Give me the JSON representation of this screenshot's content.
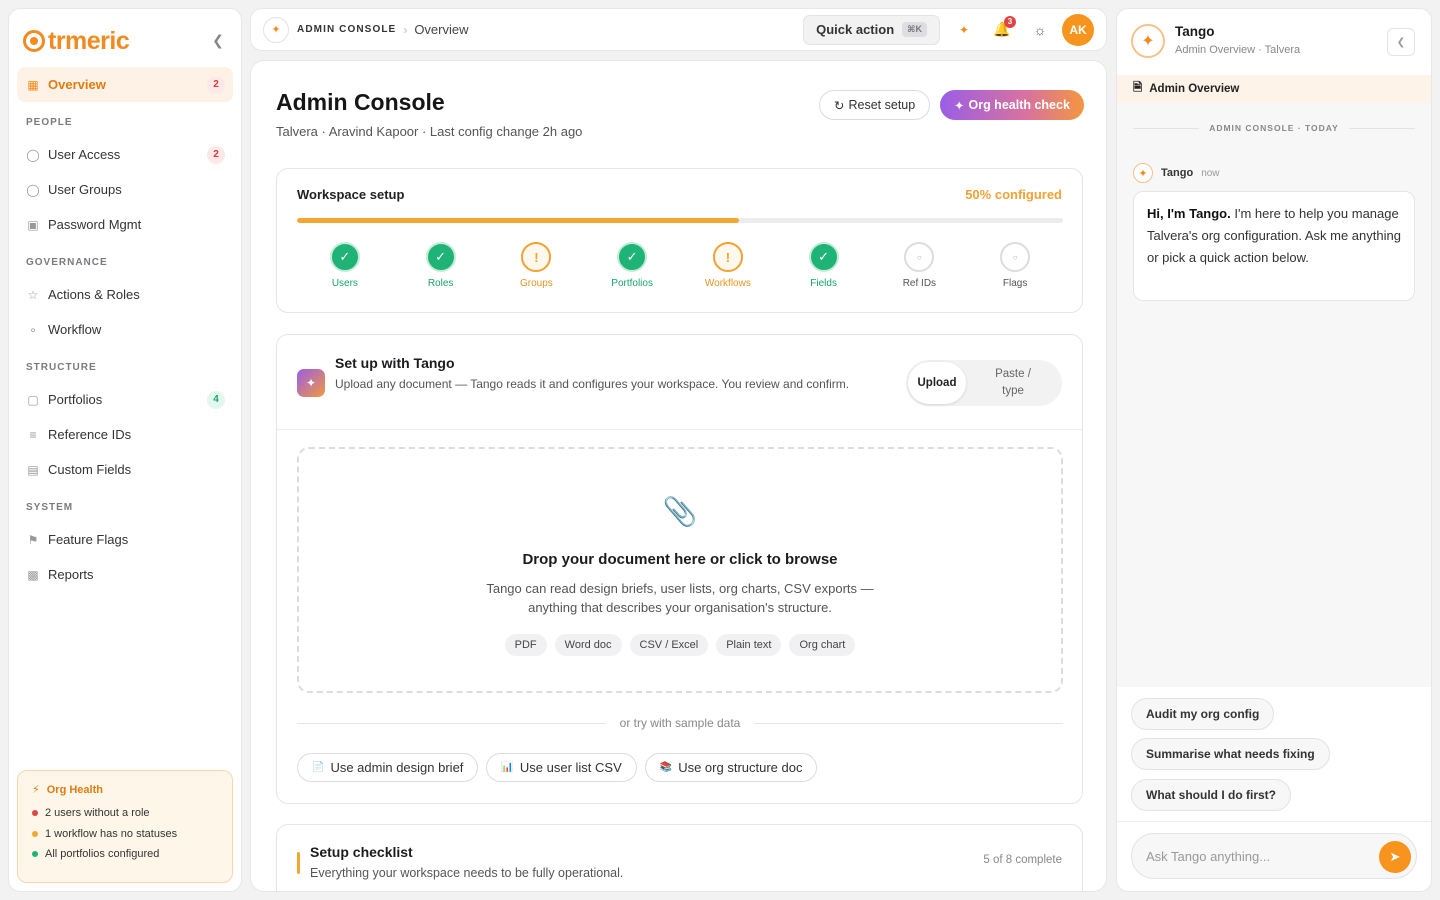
{
  "brand": {
    "name": "trmeric"
  },
  "sidebar": {
    "overview": {
      "label": "Overview",
      "badge": "2"
    },
    "sections": {
      "people": "PEOPLE",
      "governance": "GOVERNANCE",
      "structure": "STRUCTURE",
      "system": "SYSTEM"
    },
    "items": {
      "user_access": {
        "label": "User Access",
        "badge": "2"
      },
      "user_groups": {
        "label": "User Groups"
      },
      "password_mgmt": {
        "label": "Password Mgmt"
      },
      "actions_roles": {
        "label": "Actions & Roles"
      },
      "workflow": {
        "label": "Workflow"
      },
      "portfolios": {
        "label": "Portfolios",
        "badge": "4"
      },
      "reference_ids": {
        "label": "Reference IDs"
      },
      "custom_fields": {
        "label": "Custom Fields"
      },
      "feature_flags": {
        "label": "Feature Flags"
      },
      "reports": {
        "label": "Reports"
      }
    },
    "org_health": {
      "title": "Org Health",
      "rows": [
        {
          "text": "2 users without a role",
          "color": "#e24343"
        },
        {
          "text": "1 workflow has no statuses",
          "color": "#f2a72e"
        },
        {
          "text": "All portfolios configured",
          "color": "#20b377"
        }
      ]
    }
  },
  "topbar": {
    "title": "ADMIN CONSOLE",
    "crumb": "Overview",
    "quick_action": "Quick action",
    "shortcut": "⌘K",
    "notifications": "3",
    "avatar": "AK"
  },
  "main": {
    "title": "Admin Console",
    "subtitle": "Talvera · Aravind Kapoor · Last config change 2h ago",
    "reset_label": "Reset setup",
    "health_label": "Org health check",
    "workspace": {
      "title": "Workspace setup",
      "progress_label": "50% configured",
      "progress": 0.577,
      "steps": [
        {
          "label": "Users",
          "state": "done"
        },
        {
          "label": "Roles",
          "state": "done"
        },
        {
          "label": "Groups",
          "state": "warn"
        },
        {
          "label": "Portfolios",
          "state": "done"
        },
        {
          "label": "Workflows",
          "state": "warn"
        },
        {
          "label": "Fields",
          "state": "done"
        },
        {
          "label": "Ref IDs",
          "state": "todo"
        },
        {
          "label": "Flags",
          "state": "todo"
        }
      ]
    },
    "tango_setup": {
      "title": "Set up with Tango",
      "desc": "Upload any document — Tango reads it and configures your workspace. You review and confirm.",
      "toggle_upload": "Upload",
      "toggle_paste": "Paste / type",
      "drop_title": "Drop your document here or click to browse",
      "drop_desc": "Tango can read design briefs, user lists, org charts, CSV exports — anything that describes your organisation's structure.",
      "formats": [
        "PDF",
        "Word doc",
        "CSV / Excel",
        "Plain text",
        "Org chart"
      ],
      "or_text": "or try with sample data",
      "samples": [
        "Use admin design brief",
        "Use user list CSV",
        "Use org structure doc"
      ]
    },
    "checklist": {
      "title": "Setup checklist",
      "desc": "Everything your workspace needs to be fully operational.",
      "count": "5 of 8 complete"
    }
  },
  "tango": {
    "name": "Tango",
    "sub": "Admin Overview · Talvera",
    "context": "Admin Overview",
    "divider": "ADMIN CONSOLE · TODAY",
    "msg_name": "Tango",
    "msg_time": "now",
    "greeting_bold": "Hi, I'm Tango.",
    "greeting_rest": " I'm here to help you manage Talvera's org configuration. Ask me anything or pick a quick action below.",
    "suggestions": [
      "Audit my org config",
      "Summarise what needs fixing",
      "What should I do first?"
    ],
    "input_placeholder": "Ask Tango anything..."
  }
}
